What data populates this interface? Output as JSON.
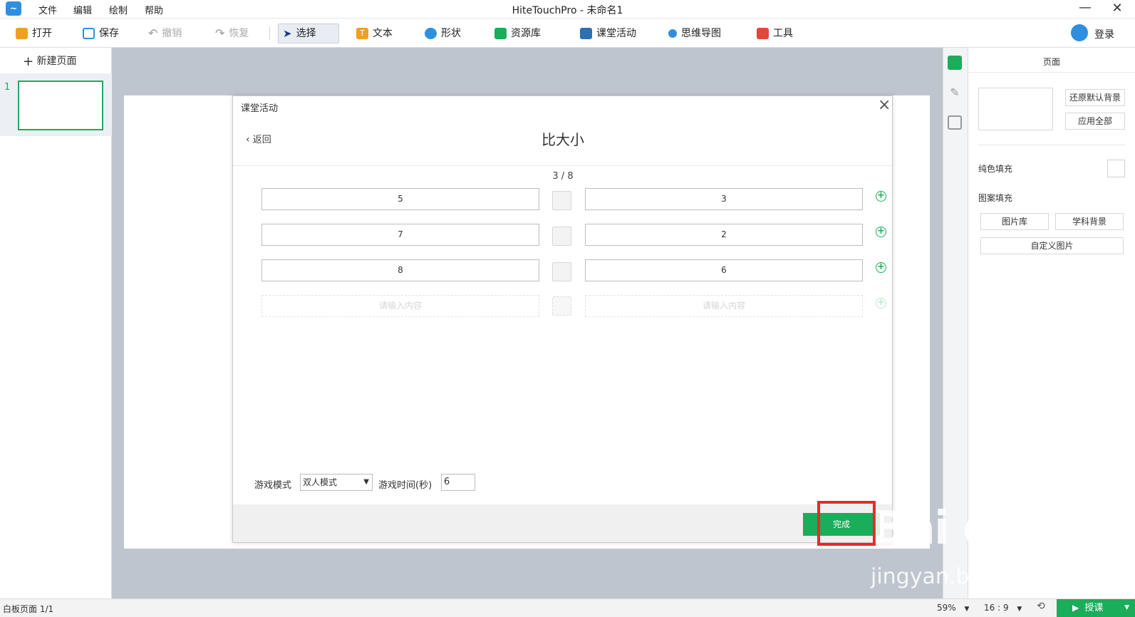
{
  "window": {
    "title": "HiteTouchPro - 未命名1",
    "min": "—",
    "close": "✕"
  },
  "menu": [
    "文件",
    "编辑",
    "绘制",
    "帮助"
  ],
  "toolbar": {
    "open": "打开",
    "save": "保存",
    "undo": "撤销",
    "redo": "恢复",
    "select": "选择",
    "text": "文本",
    "shape": "形状",
    "resources": "资源库",
    "class_activity": "课堂活动",
    "mindmap": "思维导图",
    "tools": "工具",
    "login": "登录"
  },
  "left": {
    "new_page": "新建页面",
    "page_index": "1"
  },
  "dialog": {
    "header": "课堂活动",
    "back": "返回",
    "title": "比大小",
    "counter": "3 / 8",
    "rows": [
      {
        "left": "5",
        "right": "3"
      },
      {
        "left": "7",
        "right": "2"
      },
      {
        "left": "8",
        "right": "6"
      }
    ],
    "placeholder": "请输入内容",
    "mode_label": "游戏模式",
    "mode_value": "双人模式",
    "time_label": "游戏时间(秒)",
    "time_value": "6",
    "done": "完成"
  },
  "right": {
    "header": "页面",
    "restore_bg": "还原默认背景",
    "apply_all": "应用全部",
    "solid_fill": "纯色填充",
    "pattern_fill": "图案填充",
    "gallery": "图片库",
    "subject_bg": "学科背景",
    "custom_image": "自定义图片"
  },
  "status": {
    "page": "白板页面 1/1",
    "zoom": "59%",
    "ratio": "16 : 9",
    "teach": "授课"
  },
  "watermark": {
    "line1": "Bai du 经验",
    "line2": "jingyan.baidu.com"
  },
  "colors": {
    "accent": "#1aad5a",
    "highlight": "#e8282c",
    "canvas": "#bfc5cf"
  }
}
